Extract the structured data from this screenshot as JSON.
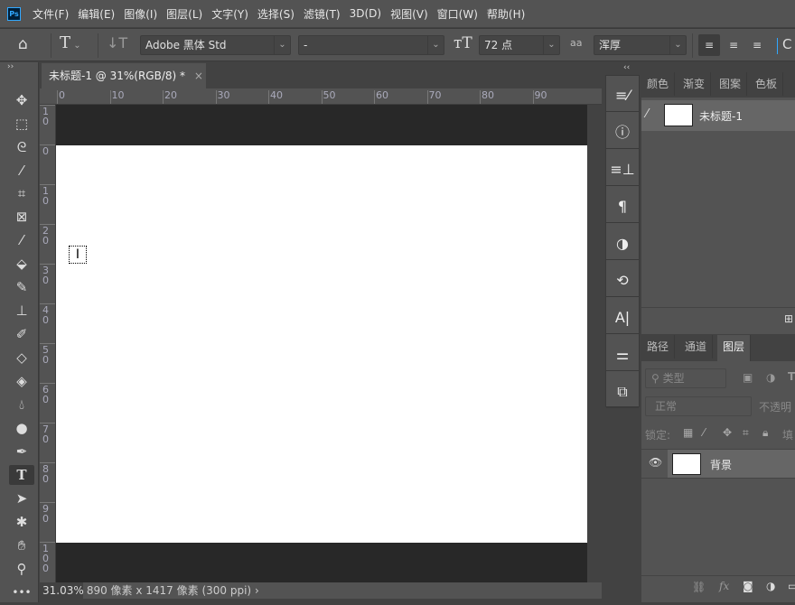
{
  "app": {
    "logo": "Ps"
  },
  "menu": [
    "文件(F)",
    "编辑(E)",
    "图像(I)",
    "图层(L)",
    "文字(Y)",
    "选择(S)",
    "滤镜(T)",
    "3D(D)",
    "视图(V)",
    "窗口(W)",
    "帮助(H)"
  ],
  "options": {
    "font_family": "Adobe 黑体 Std",
    "font_style": "-",
    "font_size": "72 点",
    "antialias": "浑厚",
    "aa_icon_label": "aa"
  },
  "document": {
    "tab_title": "未标题-1 @ 31%(RGB/8) *",
    "close": "×"
  },
  "rulers": {
    "horizontal": [
      "0",
      "10",
      "20",
      "30",
      "40",
      "50",
      "60",
      "70",
      "80",
      "90"
    ],
    "vertical": [
      "10",
      "0",
      "10",
      "20",
      "30",
      "40",
      "50",
      "60",
      "70",
      "80",
      "90",
      "100"
    ]
  },
  "status": {
    "zoom": "31.03%",
    "info": "890 像素 x 1417 像素 (300 ppi)",
    "arrow": "›"
  },
  "history_panel": {
    "tabs": [
      "颜色",
      "渐变",
      "图案",
      "色板"
    ],
    "snapshot": "未标题-1"
  },
  "layers_panel": {
    "tabs": [
      "路径",
      "通道",
      "图层"
    ],
    "active_tab": "图层",
    "filter": "类型",
    "blend_mode": "正常",
    "opacity_label": "不透明",
    "lock_label": "锁定:",
    "fill_label": "填",
    "layers": [
      {
        "name": "背景"
      }
    ]
  },
  "collapse": {
    "left": "››",
    "right": "‹‹"
  }
}
